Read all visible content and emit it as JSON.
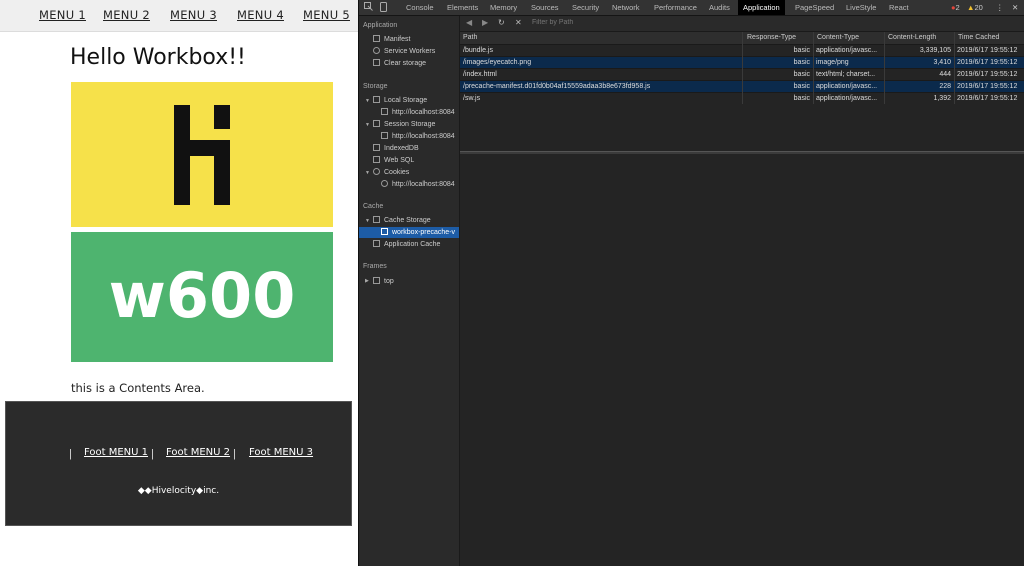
{
  "site": {
    "nav": [
      "MENU 1",
      "MENU 2",
      "MENU 3",
      "MENU 4",
      "MENU 5"
    ],
    "title": "Hello Workbox!!",
    "yellow_logo_letter": "H",
    "green_text": "w600",
    "contents": "this is a Contents Area.",
    "footer": {
      "links": [
        "Foot MENU 1",
        "Foot MENU 2",
        "Foot MENU 3"
      ],
      "separator": "|",
      "copyright": "◆◆Hivelocity◆inc."
    }
  },
  "devtools": {
    "tabs": [
      "Console",
      "Elements",
      "Memory",
      "Sources",
      "Security",
      "Network",
      "Performance",
      "Audits",
      "Application",
      "PageSpeed",
      "LiveStyle",
      "React"
    ],
    "active_tab": "Application",
    "errors": "2",
    "warnings": "20",
    "sidebar": {
      "application_header": "Application",
      "application_items": [
        "Manifest",
        "Service Workers",
        "Clear storage"
      ],
      "storage_header": "Storage",
      "local_storage": "Local Storage",
      "local_storage_child": "http://localhost:8084",
      "session_storage": "Session Storage",
      "session_storage_child": "http://localhost:8084",
      "indexeddb": "IndexedDB",
      "websql": "Web SQL",
      "cookies": "Cookies",
      "cookies_child": "http://localhost:8084",
      "cache_header": "Cache",
      "cache_storage": "Cache Storage",
      "cache_storage_child": "workbox-precache-v",
      "application_cache": "Application Cache",
      "frames_header": "Frames",
      "frames_top": "top"
    },
    "filter_placeholder": "Filter by Path",
    "table": {
      "headers": [
        "Path",
        "Response-Type",
        "Content-Type",
        "Content-Length",
        "Time Cached"
      ],
      "rows": [
        [
          "/bundle.js",
          "basic",
          "application/javasc...",
          "3,339,105",
          "2019/6/17 19:55:12"
        ],
        [
          "/images/eyecatch.png",
          "basic",
          "image/png",
          "3,410",
          "2019/6/17 19:55:12"
        ],
        [
          "/index.html",
          "basic",
          "text/html; charset...",
          "444",
          "2019/6/17 19:55:12"
        ],
        [
          "/precache-manifest.d01fd0b04af15559adaa3b8e673fd958.js",
          "basic",
          "application/javasc...",
          "228",
          "2019/6/17 19:55:12"
        ],
        [
          "/sw.js",
          "basic",
          "application/javasc...",
          "1,392",
          "2019/6/17 19:55:12"
        ]
      ]
    },
    "colors": {
      "selected": "#1d5ca6",
      "row_highlight": "#0b2a4c",
      "panel_bg": "#242424"
    }
  }
}
